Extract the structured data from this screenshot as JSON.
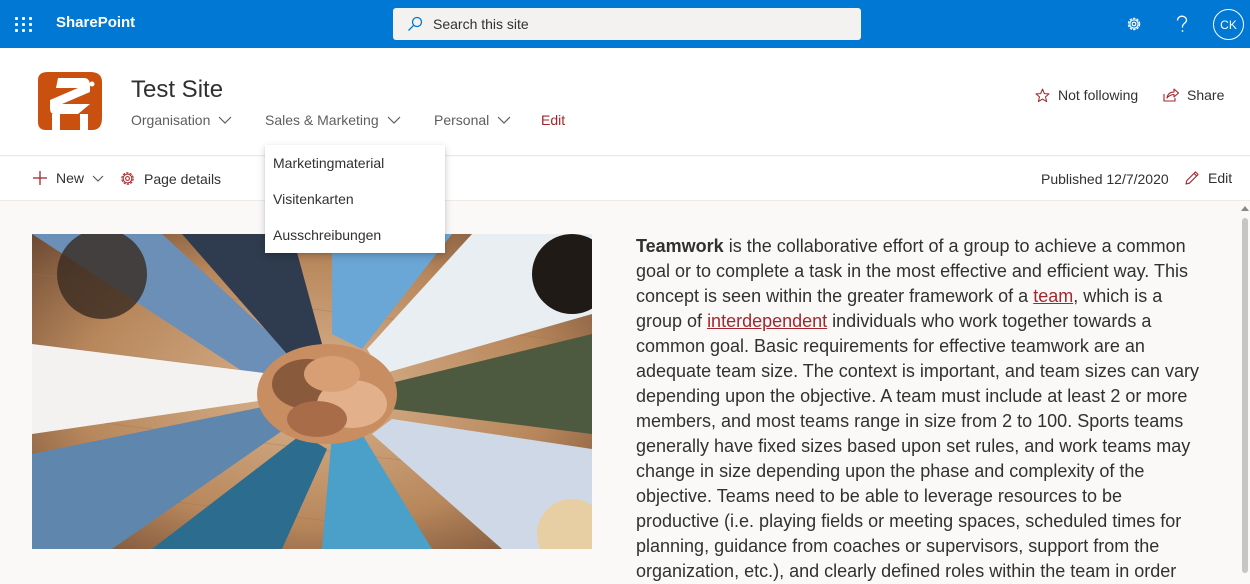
{
  "suite": {
    "brand": "SharePoint",
    "search_placeholder": "Search this site",
    "user_initials": "CK"
  },
  "site": {
    "title": "Test Site",
    "nav": [
      {
        "label": "Organisation"
      },
      {
        "label": "Sales & Marketing"
      },
      {
        "label": "Personal"
      }
    ],
    "nav_edit": "Edit",
    "follow_label": "Not following",
    "share_label": "Share"
  },
  "commandbar": {
    "new_label": "New",
    "page_details_label": "Page details",
    "published": "Published 12/7/2020",
    "edit_label": "Edit"
  },
  "dropdown": {
    "items": [
      "Marketingmaterial",
      "Visitenkarten",
      "Ausschreibungen"
    ]
  },
  "article": {
    "term": "Teamwork",
    "seg1": " is the collaborative effort of a group to achieve a common goal or to complete a task in the most effective and efficient way. This concept is seen within the greater framework of a ",
    "link1": "team",
    "seg2": ", which is a group of ",
    "link2": "interdependent",
    "seg3": " individuals who work together towards a common goal. Basic requirements for effective teamwork are an adequate team size. The context is important, and team sizes can vary depending upon the objective. A team must include at least 2 or more members, and most teams range in size from 2 to 100. Sports teams generally have fixed sizes based upon set rules, and work teams may change in size depending upon the phase and complexity of the objective. Teams need to be able to leverage resources to be productive (i.e. playing fields or meeting spaces, scheduled times for planning, guidance from coaches or supervisors, support from the organization, etc.), and clearly defined roles within the team in order"
  },
  "colors": {
    "suite_bar": "#0078d4",
    "accent": "#a4262c",
    "logo": "#ca5010"
  }
}
